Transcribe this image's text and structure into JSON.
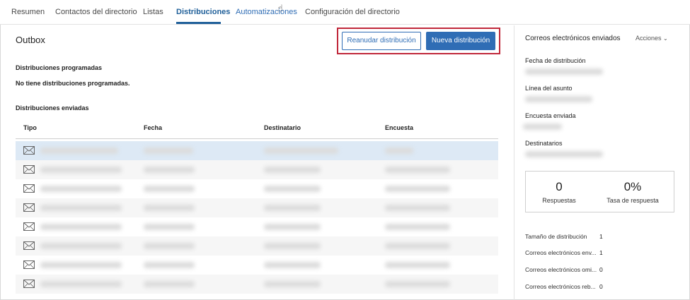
{
  "tabs": [
    {
      "label": "Resumen"
    },
    {
      "label": "Contactos del directorio"
    },
    {
      "label": "Listas"
    },
    {
      "label": "Distribuciones"
    },
    {
      "label": "Automatizaciones"
    },
    {
      "label": "Configuración del directorio"
    }
  ],
  "cursor_icon": "hand-pointer-icon",
  "outbox": {
    "title": "Outbox",
    "resume_button": "Reanudar distribución",
    "new_button": "Nueva distribución",
    "scheduled_heading": "Distribuciones programadas",
    "scheduled_empty": "No tiene distribuciones programadas.",
    "sent_heading": "Distribuciones enviadas",
    "columns": [
      "Tipo",
      "Fecha",
      "Destinatario",
      "Encuesta"
    ],
    "row_icon": "envelope-icon"
  },
  "panel": {
    "title": "Correos electrónicos enviados",
    "actions": "Acciones",
    "fields": [
      {
        "label": "Fecha de distribución"
      },
      {
        "label": "Línea del asunto"
      },
      {
        "label": "Encuesta enviada"
      },
      {
        "label": "Destinatarios"
      }
    ],
    "stats": {
      "responses_value": "0",
      "responses_label": "Respuestas",
      "rate_value": "0%",
      "rate_label": "Tasa de respuesta"
    },
    "metrics": [
      {
        "label": "Tamaño de distribución",
        "value": "1"
      },
      {
        "label": "Correos electrónicos env...",
        "value": "1"
      },
      {
        "label": "Correos electrónicos omi...",
        "value": "0"
      },
      {
        "label": "Correos electrónicos reb...",
        "value": "0"
      }
    ]
  },
  "colors": {
    "accent": "#2f6db5",
    "active_tab": "#1f5f99",
    "highlight_frame": "#c0273a",
    "selected_row": "#dde9f5"
  }
}
